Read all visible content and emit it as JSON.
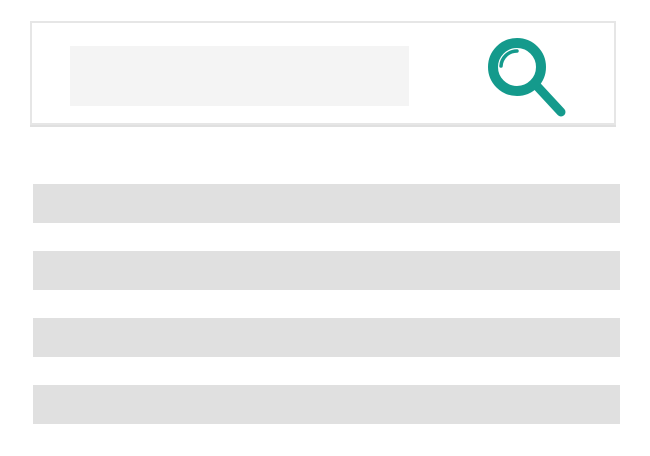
{
  "search": {
    "value": "",
    "placeholder": "",
    "button_icon": "search-icon",
    "accent_color": "#149a8c"
  },
  "results": [
    {
      "label": ""
    },
    {
      "label": ""
    },
    {
      "label": ""
    },
    {
      "label": ""
    }
  ]
}
